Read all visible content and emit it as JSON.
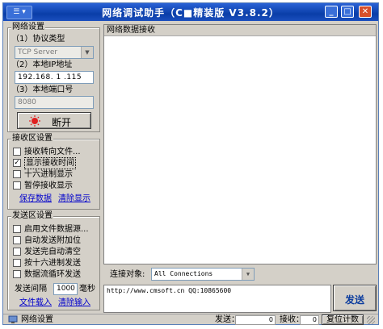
{
  "window": {
    "title": "网络调试助手（C■精装版 V3.8.2）",
    "sysmenu": "☰ ▾"
  },
  "net_settings": {
    "legend": "网络设置",
    "protocol_label": "（1）协议类型",
    "protocol_value": "TCP Server",
    "local_ip_label": "（2）本地IP地址",
    "local_ip_value": "192.168. 1 .115",
    "local_port_label": "（3）本地端口号",
    "local_port_value": "8080",
    "connect_button": "断开",
    "status_color": "#e02020"
  },
  "recv_settings": {
    "legend": "接收区设置",
    "options": [
      {
        "label": "接收转向文件...",
        "checked": false
      },
      {
        "label": "显示接收时间",
        "checked": true
      },
      {
        "label": "十六进制显示",
        "checked": false
      },
      {
        "label": "暂停接收显示",
        "checked": false
      }
    ],
    "save_data": "保存数据",
    "clear_display": "清除显示"
  },
  "send_settings": {
    "legend": "发送区设置",
    "options": [
      {
        "label": "启用文件数据源...",
        "checked": false
      },
      {
        "label": "自动发送附加位",
        "checked": false
      },
      {
        "label": "发送完自动清空",
        "checked": false
      },
      {
        "label": "按十六进制发送",
        "checked": false
      },
      {
        "label": "数据流循环发送",
        "checked": false
      }
    ],
    "interval_label": "发送间隔",
    "interval_value": "1000",
    "interval_unit": "毫秒",
    "file_load": "文件载入",
    "clear_input": "清除输入"
  },
  "recv_area": {
    "header": "网络数据接收"
  },
  "target": {
    "label": "连接对象:",
    "value": "All Connections"
  },
  "send_text": "http://www.cmsoft.cn QQ:10865600",
  "send_button": "发送",
  "statusbar": {
    "text": "网络设置",
    "send_label": "发送：",
    "send_count": "0",
    "recv_label": "接收：",
    "recv_count": "0",
    "reset_button": "复位计数"
  }
}
